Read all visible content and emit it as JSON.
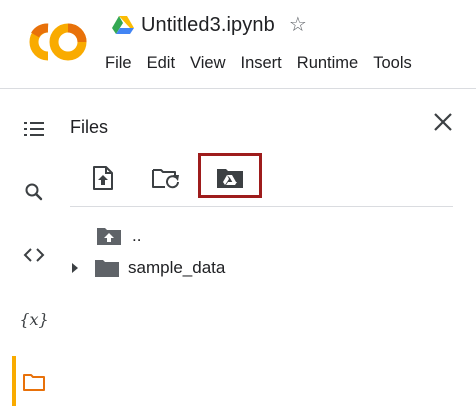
{
  "header": {
    "doc_title": "Untitled3.ipynb",
    "logo_text": "CO",
    "colors": {
      "logo_orange": "#f9ab00",
      "logo_dark_orange": "#e8710a"
    }
  },
  "menu": [
    {
      "label": "File"
    },
    {
      "label": "Edit"
    },
    {
      "label": "View"
    },
    {
      "label": "Insert"
    },
    {
      "label": "Runtime"
    },
    {
      "label": "Tools"
    }
  ],
  "rail": [
    {
      "name": "table-of-contents-icon"
    },
    {
      "name": "search-icon"
    },
    {
      "name": "code-snippets-icon"
    },
    {
      "name": "variables-icon",
      "glyph": "{x}"
    },
    {
      "name": "files-folder-icon",
      "active": true
    }
  ],
  "files_panel": {
    "title": "Files",
    "toolbar": [
      {
        "name": "upload-file-icon"
      },
      {
        "name": "refresh-folder-icon"
      },
      {
        "name": "mount-drive-icon",
        "highlighted": true
      }
    ],
    "tree": [
      {
        "label": "..",
        "icon": "folder-up-icon",
        "expandable": false
      },
      {
        "label": "sample_data",
        "icon": "folder-icon",
        "expandable": true
      }
    ]
  }
}
